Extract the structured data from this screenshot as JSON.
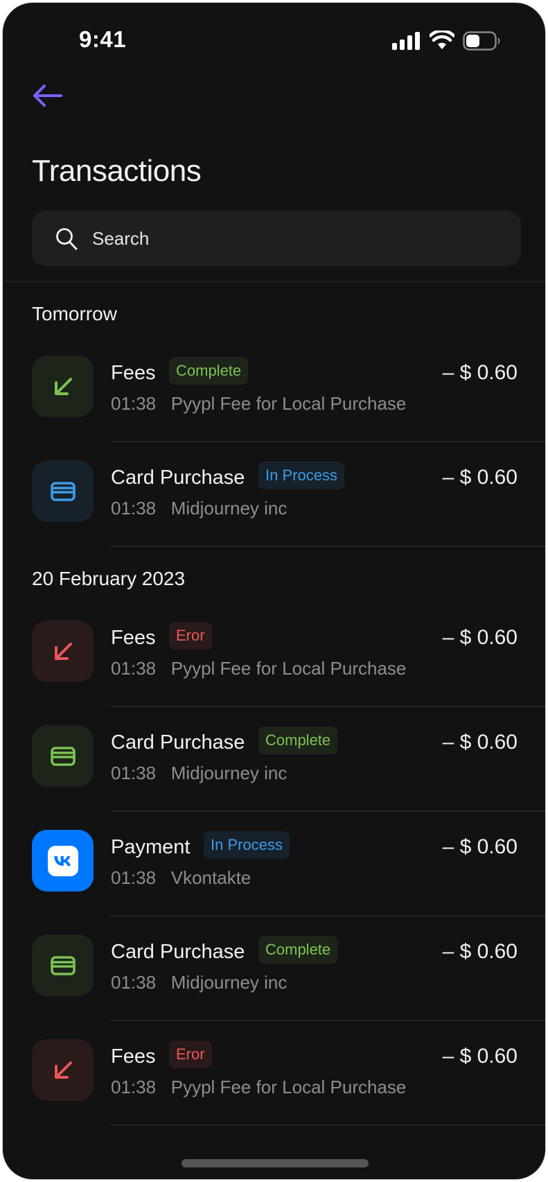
{
  "status_bar": {
    "time": "9:41",
    "icons": [
      "cellular-signal-icon",
      "wifi-icon",
      "battery-icon"
    ]
  },
  "header": {
    "back_icon": "arrow-left-icon",
    "title": "Transactions"
  },
  "search": {
    "placeholder": "Search",
    "value": "",
    "icon": "search-icon"
  },
  "colors": {
    "background": "#121212",
    "accent": "#7b61ff",
    "complete": "#7cc452",
    "in_process": "#3e9ce6",
    "error": "#e8585a",
    "vk_brand": "#0077ff"
  },
  "sections": [
    {
      "label": "Tomorrow",
      "items": [
        {
          "type": "Fees",
          "status": "Complete",
          "tone": "green",
          "icon": "arrow-down-left-icon",
          "time": "01:38",
          "description": "Pyypl Fee for Local Purchase",
          "amount": "– $ 0.60"
        },
        {
          "type": "Card Purchase",
          "status": "In Process",
          "tone": "blue",
          "icon": "credit-card-icon",
          "time": "01:38",
          "description": "Midjourney inc",
          "amount": "– $ 0.60"
        }
      ]
    },
    {
      "label": "20 February 2023",
      "items": [
        {
          "type": "Fees",
          "status": "Eror",
          "tone": "red",
          "icon": "arrow-down-left-icon",
          "time": "01:38",
          "description": "Pyypl Fee for Local Purchase",
          "amount": "– $ 0.60"
        },
        {
          "type": "Card Purchase",
          "status": "Complete",
          "tone": "green",
          "icon": "credit-card-icon",
          "time": "01:38",
          "description": "Midjourney inc",
          "amount": "– $ 0.60"
        },
        {
          "type": "Payment",
          "status": "In Process",
          "tone": "blue",
          "icon": "vk-logo-icon",
          "time": "01:38",
          "description": "Vkontakte",
          "amount": "– $ 0.60"
        },
        {
          "type": "Card Purchase",
          "status": "Complete",
          "tone": "green",
          "icon": "credit-card-icon",
          "time": "01:38",
          "description": "Midjourney inc",
          "amount": "– $ 0.60"
        },
        {
          "type": "Fees",
          "status": "Eror",
          "tone": "red",
          "icon": "arrow-down-left-icon",
          "time": "01:38",
          "description": "Pyypl Fee for Local Purchase",
          "amount": "– $ 0.60"
        }
      ]
    }
  ]
}
